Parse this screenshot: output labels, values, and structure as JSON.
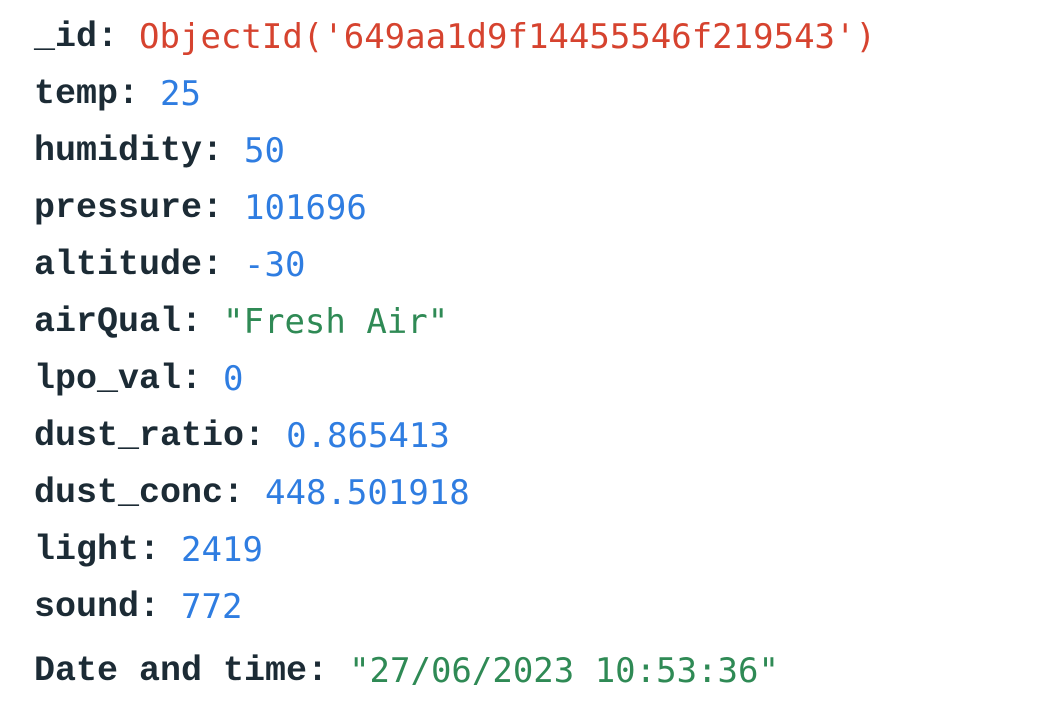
{
  "document": {
    "fields": [
      {
        "key": "_id",
        "value": "ObjectId('649aa1d9f14455546f219543')",
        "type": "objectid"
      },
      {
        "key": "temp",
        "value": "25",
        "type": "number"
      },
      {
        "key": "humidity",
        "value": "50",
        "type": "number"
      },
      {
        "key": "pressure",
        "value": "101696",
        "type": "number"
      },
      {
        "key": "altitude",
        "value": "-30",
        "type": "number"
      },
      {
        "key": "airQual",
        "value": "\"Fresh Air\"",
        "type": "string"
      },
      {
        "key": "lpo_val",
        "value": "0",
        "type": "number"
      },
      {
        "key": "dust_ratio",
        "value": "0.865413",
        "type": "number"
      },
      {
        "key": "dust_conc",
        "value": "448.501918",
        "type": "number"
      },
      {
        "key": "light",
        "value": "2419",
        "type": "number"
      },
      {
        "key": "sound",
        "value": "772",
        "type": "number"
      },
      {
        "key": "Date and time",
        "value": "\"27/06/2023 10:53:36\"",
        "type": "string"
      }
    ]
  },
  "colors": {
    "key": "#1c2b35",
    "objectid": "#d6432f",
    "number": "#2f7de1",
    "string": "#2f8a55"
  }
}
